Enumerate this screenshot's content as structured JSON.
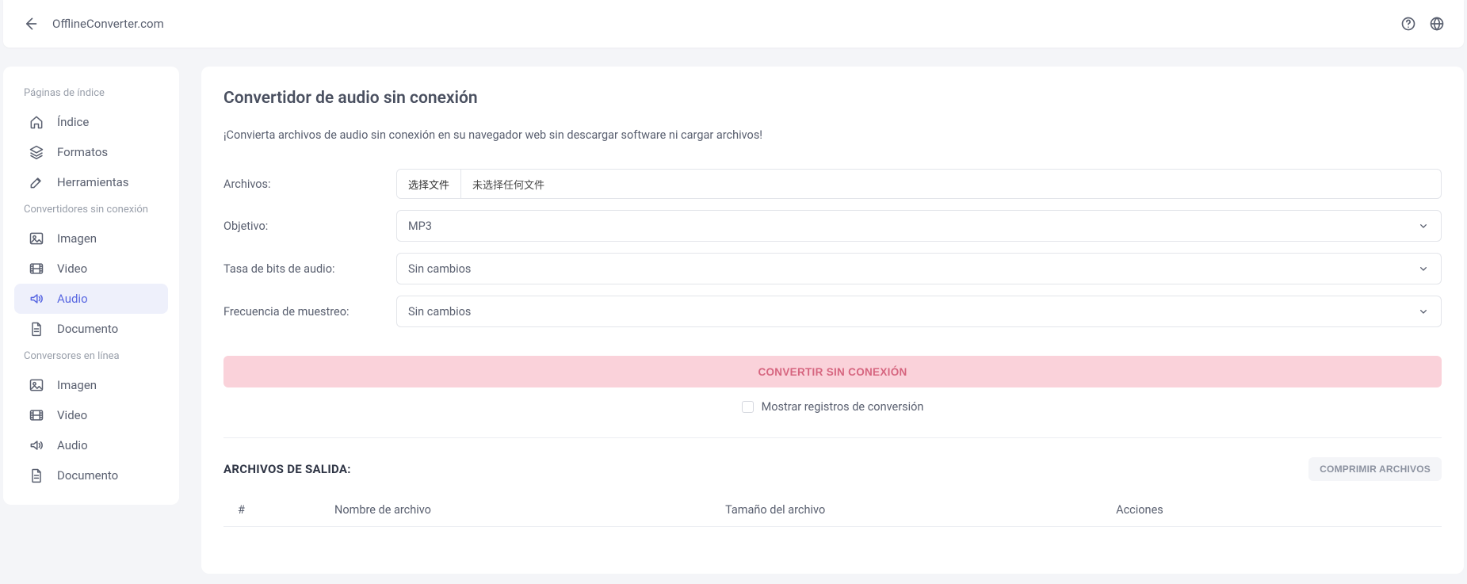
{
  "header": {
    "site_title": "OfflineConverter.com"
  },
  "sidebar": {
    "sections": [
      {
        "label": "Páginas de índice",
        "items": [
          {
            "icon": "home-icon",
            "label": "Índice"
          },
          {
            "icon": "layers-icon",
            "label": "Formatos"
          },
          {
            "icon": "edit-icon",
            "label": "Herramientas"
          }
        ]
      },
      {
        "label": "Convertidores sin conexión",
        "items": [
          {
            "icon": "image-icon",
            "label": "Imagen"
          },
          {
            "icon": "video-icon",
            "label": "Video"
          },
          {
            "icon": "audio-icon",
            "label": "Audio",
            "active": true
          },
          {
            "icon": "document-icon",
            "label": "Documento"
          }
        ]
      },
      {
        "label": "Conversores en línea",
        "items": [
          {
            "icon": "image-icon",
            "label": "Imagen"
          },
          {
            "icon": "video-icon",
            "label": "Video"
          },
          {
            "icon": "audio-icon",
            "label": "Audio"
          },
          {
            "icon": "document-icon",
            "label": "Documento"
          }
        ]
      }
    ]
  },
  "main": {
    "title": "Convertidor de audio sin conexión",
    "subtitle": "¡Convierta archivos de audio sin conexión en su navegador web sin descargar software ni cargar archivos!",
    "form": {
      "files_label": "Archivos:",
      "file_button": "选择文件",
      "file_placeholder": "未选择任何文件",
      "target_label": "Objetivo:",
      "target_value": "MP3",
      "bitrate_label": "Tasa de bits de audio:",
      "bitrate_value": "Sin cambios",
      "samplerate_label": "Frecuencia de muestreo:",
      "samplerate_value": "Sin cambios"
    },
    "convert_button": "CONVERTIR SIN CONEXIÓN",
    "show_logs_label": "Mostrar registros de conversión",
    "output": {
      "title": "ARCHIVOS DE SALIDA:",
      "compress_button": "COMPRIMIR ARCHIVOS",
      "columns": {
        "index": "#",
        "filename": "Nombre de archivo",
        "filesize": "Tamaño del archivo",
        "actions": "Acciones"
      }
    }
  }
}
